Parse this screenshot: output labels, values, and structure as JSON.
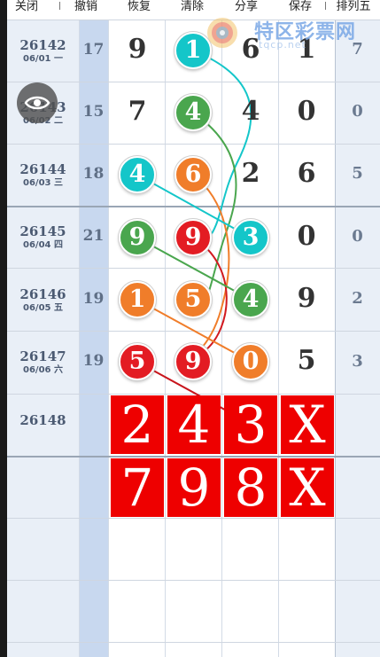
{
  "toolbar": {
    "items": [
      "关闭",
      "撤销",
      "恢复",
      "清除",
      "分享",
      "保存",
      "排列五"
    ]
  },
  "rows": [
    {
      "issue": "26142",
      "date": "06/01 一",
      "sum": "17",
      "d1": "9",
      "d2": "1",
      "d3": "6",
      "d4": "1",
      "d5": "7"
    },
    {
      "issue": "26143",
      "date": "06/02 二",
      "sum": "15",
      "d1": "7",
      "d2": "4",
      "d3": "4",
      "d4": "0",
      "d5": "0"
    },
    {
      "issue": "26144",
      "date": "06/03 三",
      "sum": "18",
      "d1": "4",
      "d2": "6",
      "d3": "2",
      "d4": "6",
      "d5": "5"
    },
    {
      "issue": "26145",
      "date": "06/04 四",
      "sum": "21",
      "d1": "9",
      "d2": "9",
      "d3": "3",
      "d4": "0",
      "d5": "0"
    },
    {
      "issue": "26146",
      "date": "06/05 五",
      "sum": "19",
      "d1": "1",
      "d2": "5",
      "d3": "4",
      "d4": "9",
      "d5": "2"
    },
    {
      "issue": "26147",
      "date": "06/06 六",
      "sum": "19",
      "d1": "5",
      "d2": "9",
      "d3": "0",
      "d4": "5",
      "d5": "3"
    }
  ],
  "next_issue": "26148",
  "picks": {
    "row1": [
      "2",
      "4",
      "3",
      "X"
    ],
    "row2": [
      "7",
      "9",
      "8",
      "X"
    ]
  },
  "watermark": {
    "name": "特区彩票网",
    "url": "tqcp.net"
  },
  "colors": {
    "red": "#e31c23",
    "green": "#4aa64e",
    "orange": "#f07d2a",
    "cyan": "#14c6c9",
    "pick_bg": "#ee0000",
    "sum_column": "#c8d8ef"
  },
  "icons": {
    "floating": "eye-icon",
    "watermark": "swirl-logo-icon"
  }
}
